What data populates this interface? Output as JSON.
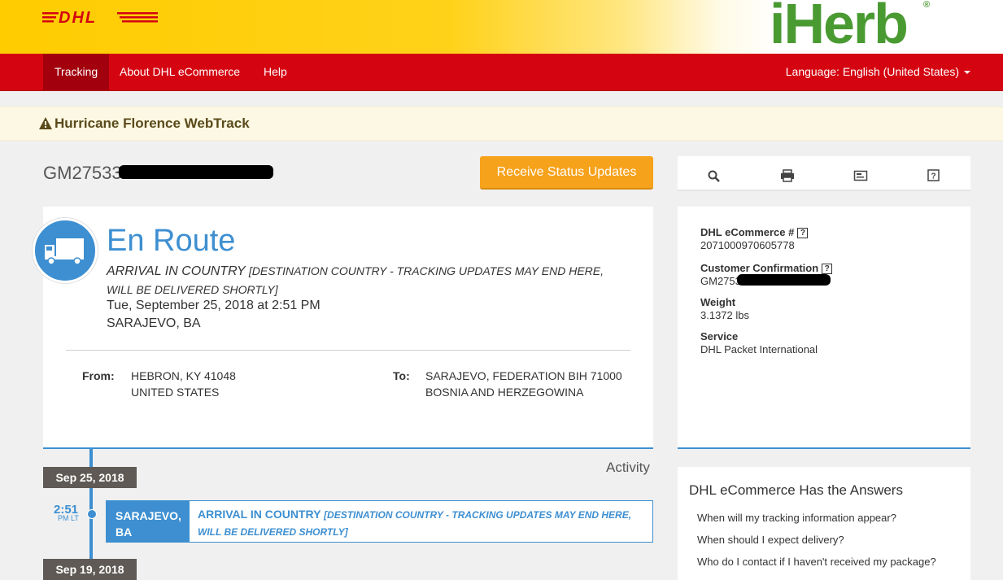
{
  "header": {
    "dhl_logo_alt": "DHL",
    "partner_logo": "iHerb",
    "partner_reg": "®"
  },
  "nav": {
    "items": [
      {
        "label": "Tracking",
        "active": true
      },
      {
        "label": "About DHL eCommerce",
        "active": false
      },
      {
        "label": "Help",
        "active": false
      }
    ],
    "language": "Language: English (United States)"
  },
  "alert": {
    "icon": "warning-icon",
    "text": "Hurricane Florence WebTrack"
  },
  "tracking": {
    "number_visible": "GM27533"
  },
  "status_button": "Receive Status Updates",
  "status": {
    "title": "En Route",
    "event": "ARRIVAL IN COUNTRY",
    "event_note_line1": "[DESTINATION COUNTRY - TRACKING UPDATES MAY END HERE,",
    "event_note_line2": "WILL BE DELIVERED SHORTLY]",
    "datetime": "Tue, September 25, 2018 at 2:51 PM",
    "location": "SARAJEVO, BA"
  },
  "from": {
    "label": "From:",
    "line1": "HEBRON, KY 41048",
    "line2": "UNITED STATES"
  },
  "to": {
    "label": "To:",
    "line1": "SARAJEVO, FEDERATION BIH 71000",
    "line2": "BOSNIA AND HERZEGOWINA"
  },
  "toolbar": {
    "icons": [
      "search-icon",
      "print-icon",
      "email-icon",
      "help-icon"
    ]
  },
  "details": {
    "ecommerce_label": "DHL eCommerce #",
    "ecommerce_value": "2071000970605778",
    "confirmation_label": "Customer Confirmation",
    "confirmation_value": "GM2753",
    "weight_label": "Weight",
    "weight_value": "3.1372 lbs",
    "service_label": "Service",
    "service_value": "DHL Packet International"
  },
  "activity": {
    "title": "Activity",
    "dates": [
      "Sep 25, 2018",
      "Sep 19, 2018"
    ],
    "event_time": "2:51",
    "event_time_sub": "PM LT",
    "event_loc_line1": "SARAJEVO,",
    "event_loc_line2": "BA",
    "event_desc": "ARRIVAL IN COUNTRY",
    "event_note_line1": "[DESTINATION COUNTRY - TRACKING UPDATES MAY END HERE,",
    "event_note_line2": "WILL BE DELIVERED SHORTLY]"
  },
  "faq": {
    "title": "DHL eCommerce Has the Answers",
    "links": [
      "When will my tracking information appear?",
      "When should I expect delivery?",
      "Who do I contact if I haven't received my package?"
    ]
  },
  "colors": {
    "dhl_red": "#d40511",
    "dhl_yellow": "#ffcc00",
    "accent_blue": "#3d8fd1",
    "button_orange": "#f7a21b"
  }
}
